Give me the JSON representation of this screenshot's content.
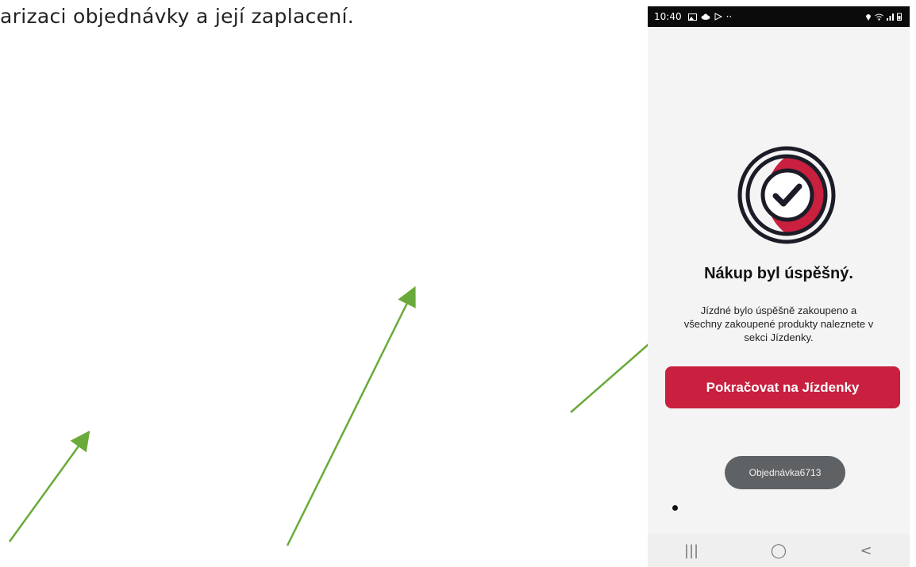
{
  "document": {
    "text": "arizaci objednávky a její zaplacení."
  },
  "phone": {
    "status_bar": {
      "time": "10:40",
      "left_icons": [
        "image-icon",
        "cloud-icon",
        "play-icon",
        "more-dots-icon"
      ],
      "right_icons": [
        "location-icon",
        "wifi-icon",
        "signal-icon",
        "battery-icon"
      ]
    },
    "success_icon": "check-circle-icon",
    "title": "Nákup byl úspěšný.",
    "description": {
      "line1": "Jízdné bylo úspěšně zakoupeno a",
      "line2": "všechny zakoupené produkty naleznete v",
      "line3": "sekci Jízdenky."
    },
    "continue_button": "Pokračovat na Jízdenky",
    "toast": "Objednávka6713",
    "nav_bar": {
      "recent": "|||",
      "home": "◯",
      "back": "<"
    }
  },
  "colors": {
    "accent": "#c8203e",
    "annotation_arrow": "#6aaa3a",
    "toast_bg": "#5f6264"
  }
}
